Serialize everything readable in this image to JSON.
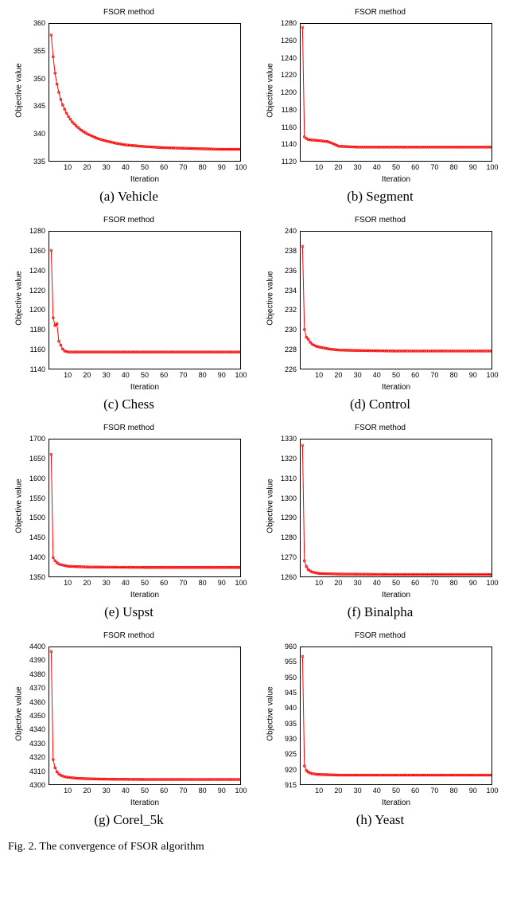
{
  "common": {
    "chart_title": "FSOR method",
    "xlabel": "Iteration",
    "ylabel": "Objective value",
    "line_color": "#ff0000",
    "xticks": [
      10,
      20,
      30,
      40,
      50,
      60,
      70,
      80,
      90,
      100
    ],
    "xlim": [
      0,
      100
    ]
  },
  "figure_caption_prefix": "Fig. 2.  The convergence of FSOR algorithm",
  "chart_data": [
    {
      "id": "vehicle",
      "caption": "(a) Vehicle",
      "type": "line",
      "title": "FSOR method",
      "xlabel": "Iteration",
      "ylabel": "Objective value",
      "xlim": [
        0,
        100
      ],
      "ylim": [
        335,
        360
      ],
      "yticks": [
        335,
        340,
        345,
        350,
        355,
        360
      ],
      "x": [
        1,
        2,
        3,
        4,
        5,
        6,
        7,
        8,
        9,
        10,
        12,
        14,
        16,
        18,
        20,
        25,
        30,
        35,
        40,
        50,
        60,
        70,
        80,
        90,
        100
      ],
      "y": [
        358,
        354,
        351,
        349,
        347.5,
        346.2,
        345.2,
        344.4,
        343.7,
        343.1,
        342.1,
        341.4,
        340.8,
        340.3,
        339.9,
        339.1,
        338.6,
        338.2,
        337.9,
        337.6,
        337.4,
        337.3,
        337.2,
        337.1,
        337.1
      ]
    },
    {
      "id": "segment",
      "caption": "(b) Segment",
      "type": "line",
      "title": "FSOR method",
      "xlabel": "Iteration",
      "ylabel": "Objective value",
      "xlim": [
        0,
        100
      ],
      "ylim": [
        1120,
        1280
      ],
      "yticks": [
        1120,
        1140,
        1160,
        1180,
        1200,
        1220,
        1240,
        1260,
        1280
      ],
      "x": [
        1,
        2,
        3,
        4,
        5,
        8,
        10,
        12,
        14,
        16,
        18,
        20,
        30,
        50,
        100
      ],
      "y": [
        1276,
        1148,
        1146,
        1145,
        1144.5,
        1144,
        1143.5,
        1143,
        1142.5,
        1141,
        1139,
        1137,
        1136,
        1136,
        1136
      ]
    },
    {
      "id": "chess",
      "caption": "(c) Chess",
      "type": "line",
      "title": "FSOR method",
      "xlabel": "Iteration",
      "ylabel": "Objective value",
      "xlim": [
        0,
        100
      ],
      "ylim": [
        1140,
        1280
      ],
      "yticks": [
        1140,
        1160,
        1180,
        1200,
        1220,
        1240,
        1260,
        1280
      ],
      "x": [
        1,
        2,
        3,
        4,
        5,
        6,
        7,
        8,
        10,
        20,
        50,
        100
      ],
      "y": [
        1261,
        1192,
        1184,
        1186,
        1168,
        1164,
        1160,
        1158,
        1157,
        1157,
        1157,
        1157
      ]
    },
    {
      "id": "control",
      "caption": "(d) Control",
      "type": "line",
      "title": "FSOR method",
      "xlabel": "Iteration",
      "ylabel": "Objective value",
      "xlim": [
        0,
        100
      ],
      "ylim": [
        226,
        240
      ],
      "yticks": [
        226,
        228,
        230,
        232,
        234,
        236,
        238,
        240
      ],
      "x": [
        1,
        2,
        3,
        4,
        5,
        6,
        8,
        10,
        15,
        20,
        30,
        50,
        100
      ],
      "y": [
        238.5,
        230,
        229.2,
        229,
        228.7,
        228.5,
        228.3,
        228.2,
        228.0,
        227.9,
        227.85,
        227.8,
        227.8
      ]
    },
    {
      "id": "uspst",
      "caption": "(e) Uspst",
      "type": "line",
      "title": "FSOR method",
      "xlabel": "Iteration",
      "ylabel": "Objective value",
      "xlim": [
        0,
        100
      ],
      "ylim": [
        1350,
        1700
      ],
      "yticks": [
        1350,
        1400,
        1450,
        1500,
        1550,
        1600,
        1650,
        1700
      ],
      "x": [
        1,
        2,
        3,
        4,
        5,
        6,
        8,
        10,
        20,
        50,
        100
      ],
      "y": [
        1662,
        1398,
        1390,
        1385,
        1382,
        1380,
        1378,
        1376,
        1374,
        1373,
        1373
      ]
    },
    {
      "id": "binalpha",
      "caption": "(f) Binalpha",
      "type": "line",
      "title": "FSOR method",
      "xlabel": "Iteration",
      "ylabel": "Objective value",
      "xlim": [
        0,
        100
      ],
      "ylim": [
        1260,
        1330
      ],
      "yticks": [
        1260,
        1270,
        1280,
        1290,
        1300,
        1310,
        1320,
        1330
      ],
      "x": [
        1,
        2,
        3,
        4,
        5,
        6,
        8,
        10,
        20,
        50,
        100
      ],
      "y": [
        1327,
        1268,
        1265,
        1263.5,
        1262.8,
        1262.3,
        1261.8,
        1261.5,
        1261.2,
        1261,
        1261
      ]
    },
    {
      "id": "corel5k",
      "caption": "(g) Corel_5k",
      "type": "line",
      "title": "FSOR method",
      "xlabel": "Iteration",
      "ylabel": "Objective value",
      "xlim": [
        0,
        100
      ],
      "ylim": [
        4300,
        4400
      ],
      "yticks": [
        4300,
        4310,
        4320,
        4330,
        4340,
        4350,
        4360,
        4370,
        4380,
        4390,
        4400
      ],
      "x": [
        1,
        2,
        3,
        4,
        5,
        6,
        8,
        10,
        15,
        20,
        30,
        50,
        100
      ],
      "y": [
        4397,
        4318,
        4312,
        4309,
        4307.5,
        4306.5,
        4305.5,
        4305,
        4304.3,
        4304,
        4303.7,
        4303.5,
        4303.5
      ]
    },
    {
      "id": "yeast",
      "caption": "(h) Yeast",
      "type": "line",
      "title": "FSOR method",
      "xlabel": "Iteration",
      "ylabel": "Objective value",
      "xlim": [
        0,
        100
      ],
      "ylim": [
        915,
        960
      ],
      "yticks": [
        915,
        920,
        925,
        930,
        935,
        940,
        945,
        950,
        955,
        960
      ],
      "x": [
        1,
        2,
        3,
        4,
        5,
        6,
        8,
        10,
        20,
        50,
        100
      ],
      "y": [
        957,
        921,
        919.5,
        919,
        918.7,
        918.5,
        918.3,
        918.2,
        918,
        918,
        918
      ]
    }
  ]
}
